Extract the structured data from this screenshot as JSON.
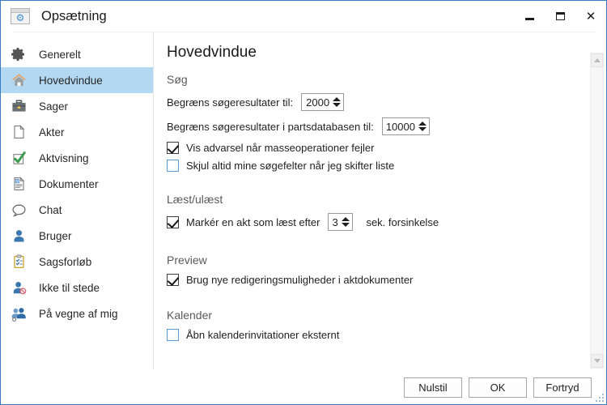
{
  "window": {
    "title": "Opsætning",
    "app_icon": "settings-window-icon",
    "controls": {
      "minimize": "minimize-icon",
      "maximize": "maximize-icon",
      "close": "close-icon"
    },
    "border_color": "#3a7cc4"
  },
  "sidebar": {
    "selected": "Hovedvindue",
    "highlight_color": "#b3d9f2",
    "items": [
      {
        "label": "Generelt",
        "icon": "gear-icon"
      },
      {
        "label": "Hovedvindue",
        "icon": "home-icon"
      },
      {
        "label": "Sager",
        "icon": "briefcase-icon"
      },
      {
        "label": "Akter",
        "icon": "page-icon"
      },
      {
        "label": "Aktvisning",
        "icon": "checkbox-check-icon"
      },
      {
        "label": "Dokumenter",
        "icon": "document-text-icon"
      },
      {
        "label": "Chat",
        "icon": "speech-bubble-icon"
      },
      {
        "label": "Bruger",
        "icon": "person-icon"
      },
      {
        "label": "Sagsforløb",
        "icon": "clipboard-icon"
      },
      {
        "label": "Ikke til stede",
        "icon": "person-blocked-icon"
      },
      {
        "label": "På vegne af mig",
        "icon": "people-group-icon"
      }
    ]
  },
  "content": {
    "page_title": "Hovedvindue",
    "groups": [
      {
        "title": "Søg",
        "limit_results_label": "Begræns søgeresultater til:",
        "limit_results_value": "2000",
        "limit_party_label": "Begræns søgeresultater i partsdatabasen til:",
        "limit_party_value": "10000",
        "checkbox_warning_label": "Vis advarsel når masseoperationer fejler",
        "checkbox_warning_checked": true,
        "checkbox_hide_label": "Skjul altid mine søgefelter når jeg skifter liste",
        "checkbox_hide_checked": false
      },
      {
        "title": "Læst/ulæst",
        "mark_read_label": "Markér en akt som læst efter",
        "mark_read_checked": true,
        "mark_read_value": "3",
        "mark_read_suffix": "sek. forsinkelse"
      },
      {
        "title": "Preview",
        "preview_label": "Brug nye redigeringsmuligheder i aktdokumenter",
        "preview_checked": true
      },
      {
        "title": "Kalender",
        "calendar_label": "Åbn kalenderinvitationer eksternt",
        "calendar_checked": false
      }
    ]
  },
  "scrollbar": {
    "up_icon": "scroll-up-arrow-icon",
    "down_icon": "scroll-down-arrow-icon"
  },
  "footer": {
    "reset_label": "Nulstil",
    "ok_label": "OK",
    "cancel_label": "Fortryd"
  }
}
